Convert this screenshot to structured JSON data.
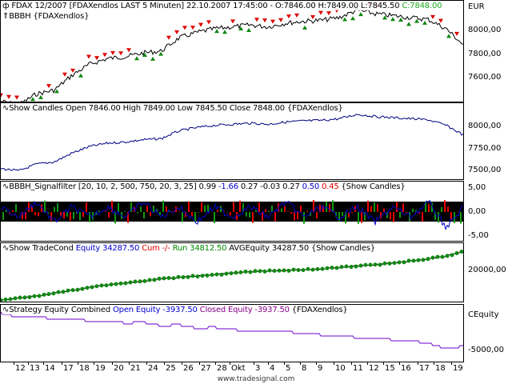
{
  "panels": [
    {
      "header": {
        "icon": "price-bar-icon",
        "text": "FDAX 12/2007 [FDAXendlos LAST 5 Minuten] 22.10.2007 17:45:00 - O:7846.00 H:7849.00 L:7845.50 ",
        "close": "C:7848.00"
      },
      "sub_header": "BBBH {FDAXendlos}",
      "unit": "EUR",
      "yticks": [
        "8000,00",
        "7800,00",
        "7600,00"
      ]
    },
    {
      "header": {
        "name": "Show Candles",
        "text": "Show Candles Open 7846.00 High 7849.00 Low 7845.50 Close 7848.00 {FDAXendlos}"
      },
      "yticks": [
        "8000,00",
        "7750,00",
        "7500,00"
      ]
    },
    {
      "header": {
        "name": "BBBH_Signalfilter [20, 10, 2, 500, 750, 20, 3, 25]",
        "v1": "0.99",
        "v2": "-1.66",
        "v3": "0.27 -0.03 0.27",
        "v4": "0.50",
        "v5": "0.45",
        "src": "{Show Candles}"
      },
      "yticks": [
        "5,00",
        "0,00",
        "-5,00"
      ]
    },
    {
      "header": {
        "name": "Show TradeCond",
        "eq": "Equity 34287.50",
        "cum": "Cum -/-",
        "run": "Run 34812.50",
        "avg": "AVGEquity 34287.50 {Show Candles}"
      },
      "yticks": [
        "20000,00"
      ]
    },
    {
      "header": {
        "name": "Strategy Equity Combined",
        "open": "Open Equity -3937.50",
        "closed": "Closed Equity -3937.50",
        "src": "{FDAXendlos}"
      },
      "unit": "CEquity",
      "yticks": [
        "-5000,00"
      ]
    }
  ],
  "chart_data": {
    "type": "line",
    "x_ticks": [
      "12",
      "13",
      "14",
      "17",
      "18",
      "19",
      "20",
      "21",
      "24",
      "25",
      "26",
      "27",
      "28",
      "Okt",
      "3",
      "4",
      "5",
      "8",
      "9",
      "10",
      "11",
      "12",
      "15",
      "16",
      "17",
      "18",
      "19"
    ],
    "series": [
      {
        "name": "Price Close",
        "values": [
          7560,
          7540,
          7600,
          7620,
          7700,
          7760,
          7790,
          7800,
          7820,
          7830,
          7900,
          7930,
          7950,
          7960,
          7970,
          7960,
          7980,
          7990,
          7995,
          8010,
          8050,
          8030,
          8020,
          8010,
          8000,
          7950,
          7860
        ]
      },
      {
        "name": "Show Candles Close",
        "values": [
          7560,
          7540,
          7600,
          7620,
          7700,
          7760,
          7790,
          7800,
          7820,
          7830,
          7900,
          7930,
          7950,
          7960,
          7970,
          7960,
          7980,
          7990,
          7995,
          8010,
          8050,
          8030,
          8020,
          8010,
          8000,
          7950,
          7860
        ]
      },
      {
        "name": "Signalfilter",
        "values": [
          1,
          -1,
          2,
          -2,
          1,
          -1,
          1,
          -1,
          2,
          -1,
          1,
          -2,
          1,
          -1,
          1,
          -1,
          2,
          -1,
          1,
          -1,
          1,
          -2,
          1,
          -1,
          2,
          -3,
          0.99
        ]
      },
      {
        "name": "Equity",
        "values": [
          0,
          1500,
          3000,
          5000,
          7000,
          9000,
          11000,
          12000,
          13500,
          15000,
          16000,
          17000,
          18000,
          19000,
          20000,
          20500,
          21000,
          21500,
          22000,
          23000,
          24000,
          25000,
          26000,
          27500,
          29000,
          31000,
          34287.5
        ]
      },
      {
        "name": "Combined Equity",
        "values": [
          0,
          -500,
          -300,
          -800,
          -600,
          -1000,
          -900,
          -1200,
          -1100,
          -1500,
          -1400,
          -1800,
          -1700,
          -2000,
          -2100,
          -2300,
          -2200,
          -2500,
          -2600,
          -2800,
          -2900,
          -3000,
          -3200,
          -3300,
          -3600,
          -4300,
          -3937.5
        ]
      }
    ],
    "ylim": [
      [
        7550,
        8100
      ],
      [
        7450,
        8150
      ],
      [
        -6,
        6
      ],
      [
        -2000,
        40000
      ],
      [
        -6000,
        1000
      ]
    ]
  },
  "footer": "www.tradesignal.com"
}
